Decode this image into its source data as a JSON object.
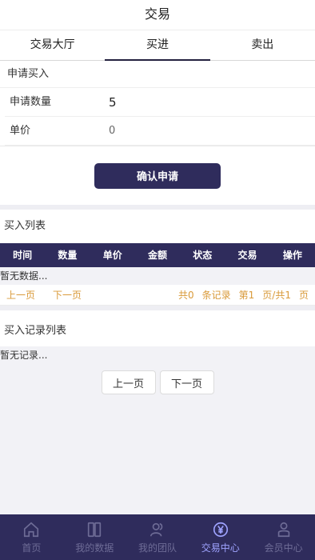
{
  "header": {
    "title": "交易"
  },
  "tabs": [
    {
      "label": "交易大厅"
    },
    {
      "label": "买进"
    },
    {
      "label": "卖出"
    }
  ],
  "apply": {
    "section_title": "申请买入",
    "quantity_label": "申请数量",
    "quantity_value": "5",
    "price_label": "单价",
    "price_value": "0",
    "confirm_label": "确认申请"
  },
  "buy_list": {
    "title": "买入列表",
    "columns": [
      "时间",
      "数量",
      "单价",
      "金额",
      "状态",
      "交易",
      "操作"
    ],
    "empty_text": "暂无数据...",
    "prev_label": "上一页",
    "next_label": "下一页",
    "total_text": "共0",
    "records_text": "条记录",
    "page_text": "第1",
    "pages_text": "页/共1",
    "page_unit": "页"
  },
  "record_list": {
    "title": "买入记录列表",
    "empty_text": "暂无记录...",
    "prev_label": "上一页",
    "next_label": "下一页"
  },
  "nav": [
    {
      "label": "首页",
      "icon": "home-icon"
    },
    {
      "label": "我的数据",
      "icon": "book-icon"
    },
    {
      "label": "我的团队",
      "icon": "team-icon"
    },
    {
      "label": "交易中心",
      "icon": "yen-icon"
    },
    {
      "label": "会员中心",
      "icon": "user-icon"
    }
  ],
  "colors": {
    "primary": "#2f2c5c",
    "pager_text": "#d99a3a",
    "nav_active": "#9fa3ff",
    "nav_inactive": "#6e6c96"
  }
}
